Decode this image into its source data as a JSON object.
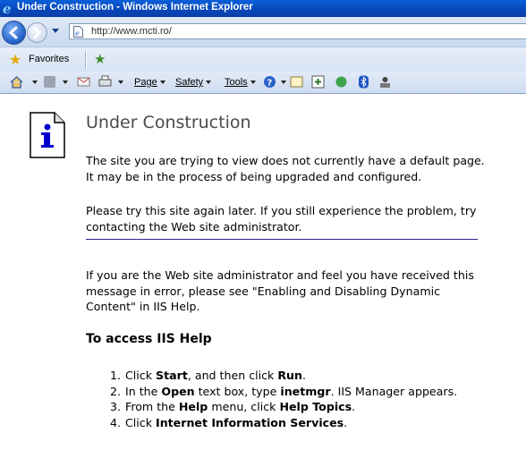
{
  "window": {
    "title": "Under Construction - Windows Internet Explorer"
  },
  "nav": {
    "url": "http://www.mcti.ro/"
  },
  "favorites": {
    "label": "Favorites"
  },
  "commandbar": {
    "page": "Page",
    "safety": "Safety",
    "tools": "Tools"
  },
  "page": {
    "heading": "Under Construction",
    "p1": "The site you are trying to view does not currently have a default page. It may be in the process of being upgraded and configured.",
    "p2": "Please try this site again later. If you still experience the problem, try contacting the Web site administrator.",
    "p3": "If you are the Web site administrator and feel you have received this message in error, please see \"Enabling and Disabling Dynamic Content\" in IIS Help.",
    "help_heading": "To access IIS Help",
    "steps": [
      {
        "a": "Click ",
        "b1": "Start",
        "c": ", and then click ",
        "b2": "Run",
        "d": "."
      },
      {
        "a": "In the ",
        "b1": "Open",
        "c": " text box, type ",
        "b2": "inetmgr",
        "d": ". IIS Manager appears."
      },
      {
        "a": "From the ",
        "b1": "Help",
        "c": " menu, click ",
        "b2": "Help Topics",
        "d": "."
      },
      {
        "a": "Click ",
        "b1": "Internet Information Services",
        "c": "",
        "b2": "",
        "d": "."
      }
    ]
  },
  "colors": {
    "titlebar": "#0746b8",
    "rule": "#2b2b8c"
  }
}
